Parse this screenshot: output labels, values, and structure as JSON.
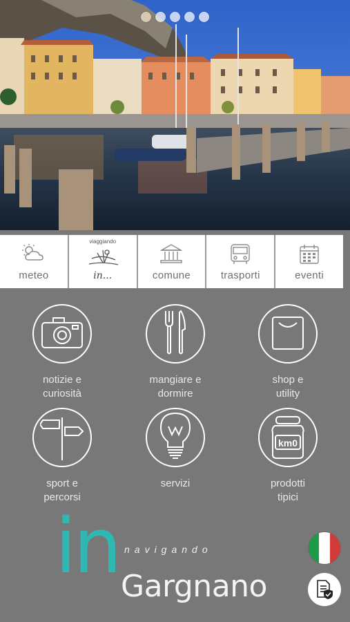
{
  "hero": {
    "image_desc_icon": "harbor-photo",
    "slides": 5,
    "active_slide": 1
  },
  "toolbar": {
    "items": [
      {
        "label": "meteo",
        "icon": "weather-icon"
      },
      {
        "small": "viaggiando",
        "label": "in...",
        "icon": "travel-logo-icon"
      },
      {
        "label": "comune",
        "icon": "town-hall-icon"
      },
      {
        "label": "trasporti",
        "icon": "bus-icon"
      },
      {
        "label": "eventi",
        "icon": "calendar-icon"
      }
    ]
  },
  "grid": {
    "tiles": [
      {
        "label": "notizie e\ncuriosità",
        "icon": "camera-icon"
      },
      {
        "label": "mangiare e\ndormire",
        "icon": "fork-knife-icon"
      },
      {
        "label": "shop e\nutility",
        "icon": "shopping-bag-icon"
      },
      {
        "label": "sport e\npercorsi",
        "icon": "signpost-icon"
      },
      {
        "label": "servizi",
        "icon": "lightbulb-icon"
      },
      {
        "label": "prodotti\ntipici",
        "icon": "jar-icon",
        "jar_text": "km0"
      }
    ]
  },
  "brand": {
    "in": "in",
    "sub": "navigando",
    "name": "Gargnano"
  },
  "colors": {
    "background": "#787878",
    "accent": "#2eb8b3"
  }
}
